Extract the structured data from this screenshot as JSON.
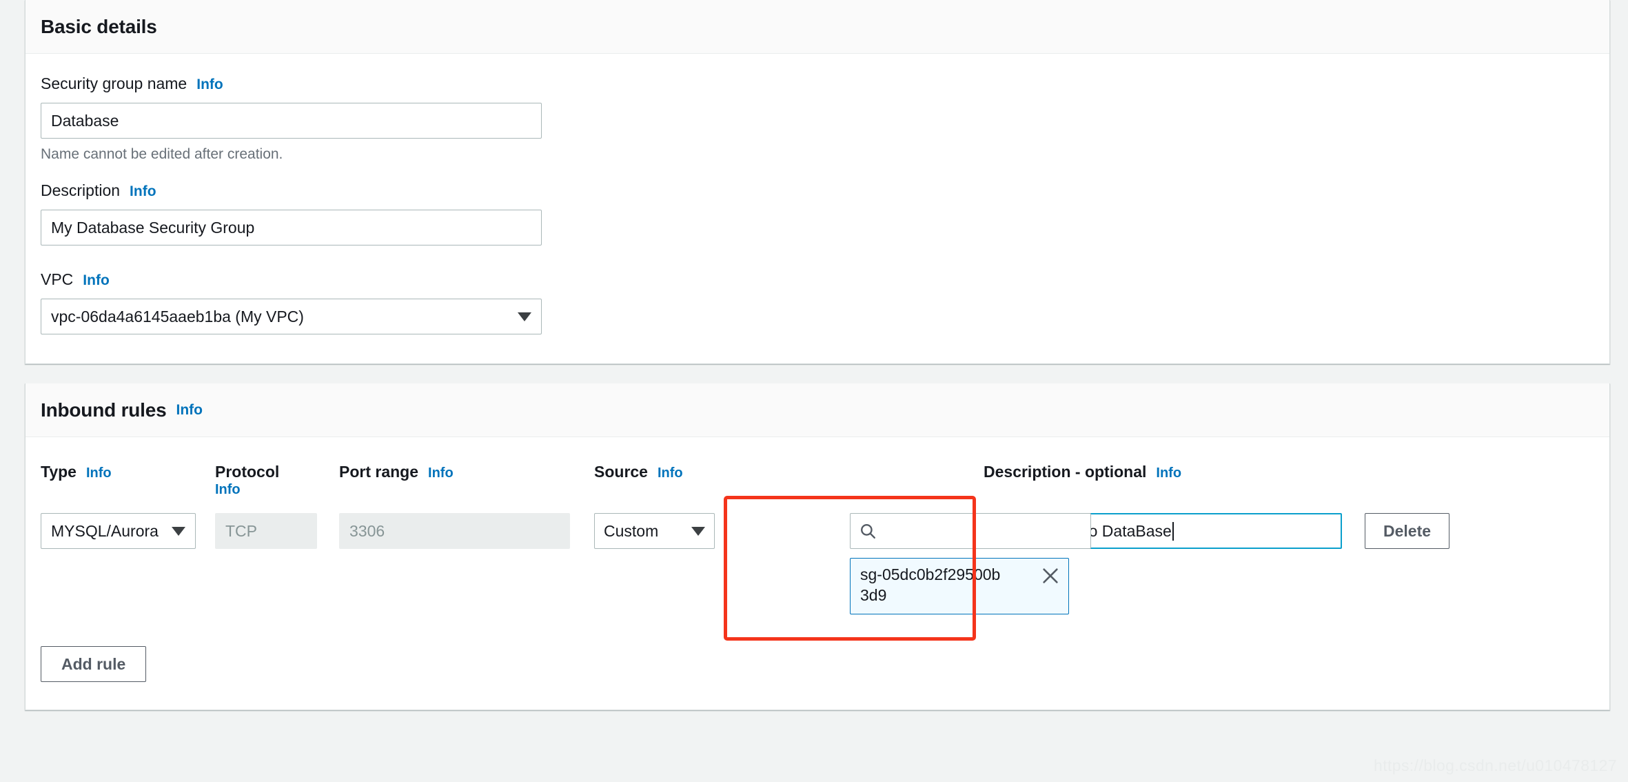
{
  "basic_details": {
    "title": "Basic details",
    "info_label": "Info",
    "security_group_name": {
      "label": "Security group name",
      "value": "Database",
      "hint": "Name cannot be edited after creation."
    },
    "description": {
      "label": "Description",
      "value": "My Database Security Group"
    },
    "vpc": {
      "label": "VPC",
      "value": "vpc-06da4a6145aaeb1ba (My VPC)"
    }
  },
  "inbound_rules": {
    "title": "Inbound rules",
    "info_label": "Info",
    "columns": {
      "type": "Type",
      "protocol": "Protocol",
      "port_range": "Port range",
      "source": "Source",
      "description": "Description - optional"
    },
    "rows": [
      {
        "type": "MYSQL/Aurora",
        "protocol": "TCP",
        "port_range": "3306",
        "source_type": "Custom",
        "source_search_value": "",
        "source_token": "sg-05dc0b2f29500b3d9",
        "description": "Web access to DataBase",
        "delete_label": "Delete"
      }
    ],
    "add_rule_label": "Add rule"
  },
  "watermark": "https://blog.csdn.net/u010478127",
  "colors": {
    "page_background": "#f1f3f3",
    "panel_background": "#ffffff",
    "panel_header_background": "#fafafa",
    "info_link": "#0073bb",
    "highlight_outline": "#f4341b",
    "focus_border": "#0a9fcc",
    "token_border": "#0073bb",
    "token_background": "#f1faff",
    "disabled_text": "#879596"
  }
}
